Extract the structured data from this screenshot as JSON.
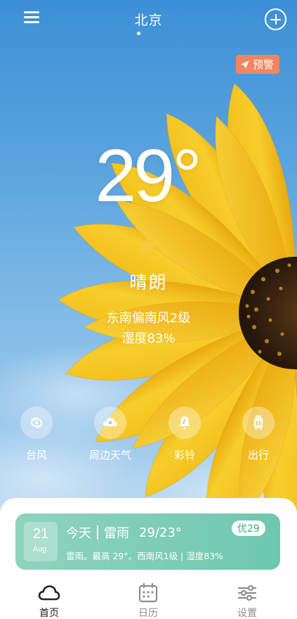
{
  "header": {
    "city": "北京"
  },
  "warning": {
    "label": "预警",
    "color": "#f2855f"
  },
  "weather": {
    "temperature": "29",
    "degree_symbol": "°",
    "condition": "晴朗",
    "condition_icon": "sun-icon",
    "wind": "东南偏南风2级",
    "humidity": "湿度83%"
  },
  "quick_actions": [
    {
      "label": "台风",
      "icon": "typhoon-icon"
    },
    {
      "label": "周边天气",
      "icon": "nearby-weather-icon"
    },
    {
      "label": "彩铃",
      "icon": "ringtone-icon"
    },
    {
      "label": "出行",
      "icon": "luggage-icon"
    }
  ],
  "forecast": {
    "day": "21",
    "month": "Aug.",
    "when": "今天",
    "condition": "雷雨",
    "temp_range": "29/23°",
    "detail": "雷雨。最高 29°。西南风1级 | 湿度83%",
    "aqi": "优29",
    "aqi_color": "#34b27b",
    "card_color": "#7fcdb6"
  },
  "tabs": [
    {
      "label": "首页",
      "icon": "cloud-icon",
      "active": true
    },
    {
      "label": "日历",
      "icon": "calendar-icon",
      "active": false
    },
    {
      "label": "设置",
      "icon": "settings-sliders-icon",
      "active": false
    }
  ]
}
